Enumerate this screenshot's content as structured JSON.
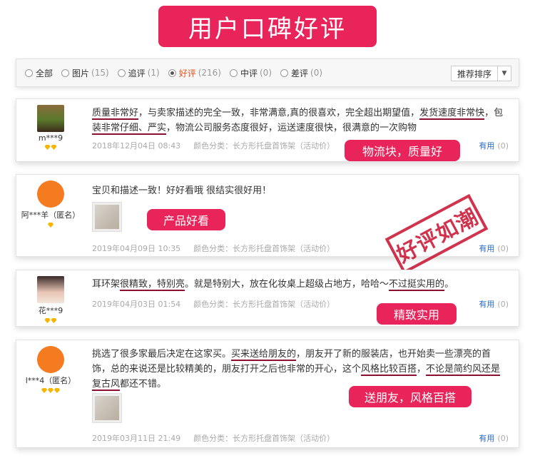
{
  "banner": {
    "title": "用户口碑好评"
  },
  "filters": [
    {
      "label": "全部",
      "count": "",
      "selected": false
    },
    {
      "label": "图片",
      "count": "(15)",
      "selected": false
    },
    {
      "label": "追评",
      "count": "(1)",
      "selected": false
    },
    {
      "label": "好评",
      "count": "(216)",
      "selected": true
    },
    {
      "label": "中评",
      "count": "(0)",
      "selected": false
    },
    {
      "label": "差评",
      "count": "(0)",
      "selected": false
    }
  ],
  "sort": {
    "label": "推荐排序"
  },
  "reviews": [
    {
      "user": "m***9",
      "text_parts": [
        "质量非常好",
        "，与卖家描述的完全一致，非常满意,真的很喜欢，完全超出期望值，",
        "发货速度非常快",
        "，包",
        "装非常仔细、严实",
        "，物流公司服务态度很好，运送速度很快，很满意的一次购物"
      ],
      "date": "2018年12月04日 08:43",
      "spec": "颜色分类：长方形托盘首饰架（活动价）",
      "useful_label": "有用",
      "useful_count": "(0)",
      "tag": "物流块，质量好"
    },
    {
      "user": "阿***羊（匿名）",
      "text_parts": [
        "宝贝和描述一致！好好看哦 很结实很好用！"
      ],
      "date": "2019年04月09日 10:35",
      "spec": "颜色分类：长方形托盘首饰架（活动价）",
      "useful_label": "有用",
      "useful_count": "(0)",
      "tag": "产品好看"
    },
    {
      "user": "花***9",
      "text_parts": [
        "耳环架",
        "很精致，特别亮",
        "。就是特别大，放在化妆桌上超级占地方，哈哈～",
        "不过挺实用的",
        "。"
      ],
      "date": "2019年04月03日 01:54",
      "spec": "颜色分类：长方形托盘首饰架（活动价）",
      "useful_label": "有用",
      "useful_count": "(0)",
      "tag": "精致实用"
    },
    {
      "user": "l***4（匿名）",
      "text_parts": [
        "挑选了很多家最后决定在这家买。",
        "买来送给朋友的",
        "，朋友开了新的服装店，也开始卖一些漂亮的首饰，总的来说还是比较精美的，朋友打开之后也非常的开心，这个",
        "风格比较百搭",
        "，",
        "不论是简约风还是复古风",
        "都还不错。"
      ],
      "date": "2019年03月11日 21:49",
      "spec": "颜色分类：长方形托盘首饰架（活动价）",
      "useful_label": "有用",
      "useful_count": "(0)",
      "tag": "送朋友，风格百搭"
    }
  ],
  "stamp": {
    "text": "好评如潮"
  },
  "colors": {
    "accent": "#e8245a",
    "underline": "#8b0f2e",
    "link": "#2a6bc4",
    "stamp": "#c8102e"
  }
}
